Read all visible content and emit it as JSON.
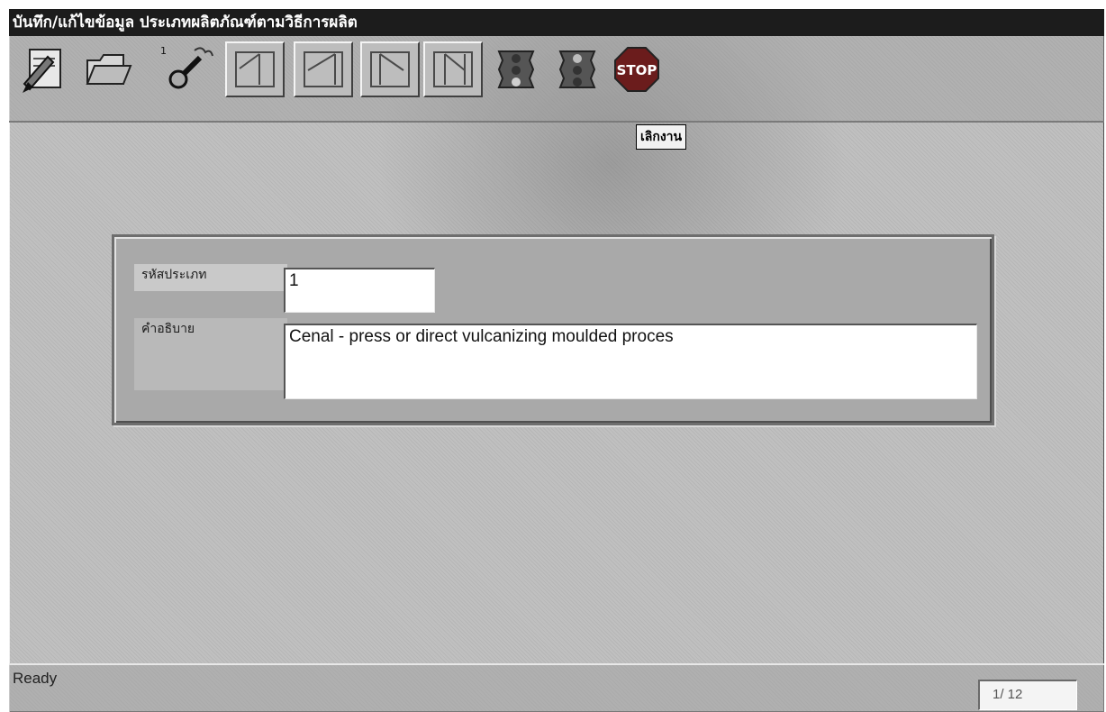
{
  "window": {
    "title": "บันทึก/แก้ไขข้อมูล ประเภทผลิตภัณฑ์ตามวิธีการผลิต"
  },
  "toolbar": {
    "buttons": [
      {
        "name": "edit-record-button",
        "icon": "pencil-paper-icon"
      },
      {
        "name": "open-folder-button",
        "icon": "folder-icon"
      },
      {
        "name": "search-button",
        "icon": "magnifier-icon"
      },
      {
        "name": "first-record-button",
        "icon": "first-icon"
      },
      {
        "name": "previous-record-button",
        "icon": "previous-icon"
      },
      {
        "name": "next-record-button",
        "icon": "next-icon"
      },
      {
        "name": "last-record-button",
        "icon": "last-icon"
      },
      {
        "name": "traffic-light-button-1",
        "icon": "traffic-light-icon"
      },
      {
        "name": "traffic-light-button-2",
        "icon": "traffic-light-icon"
      },
      {
        "name": "stop-button",
        "icon": "stop-sign-icon",
        "label": "STOP"
      }
    ],
    "tooltip": "เลิกงาน"
  },
  "form": {
    "type_code": {
      "label": "รหัสประเภท",
      "value": "1"
    },
    "description": {
      "label": "คำอธิบาย",
      "value": "Cenal - press or direct vulcanizing moulded proces"
    }
  },
  "status": {
    "text": "Ready",
    "record_position": "1/ 12"
  },
  "colors": {
    "title_bg": "#1c1c1c",
    "stop_red": "#7a1e1e",
    "window_bg": "#c0c0c0"
  }
}
